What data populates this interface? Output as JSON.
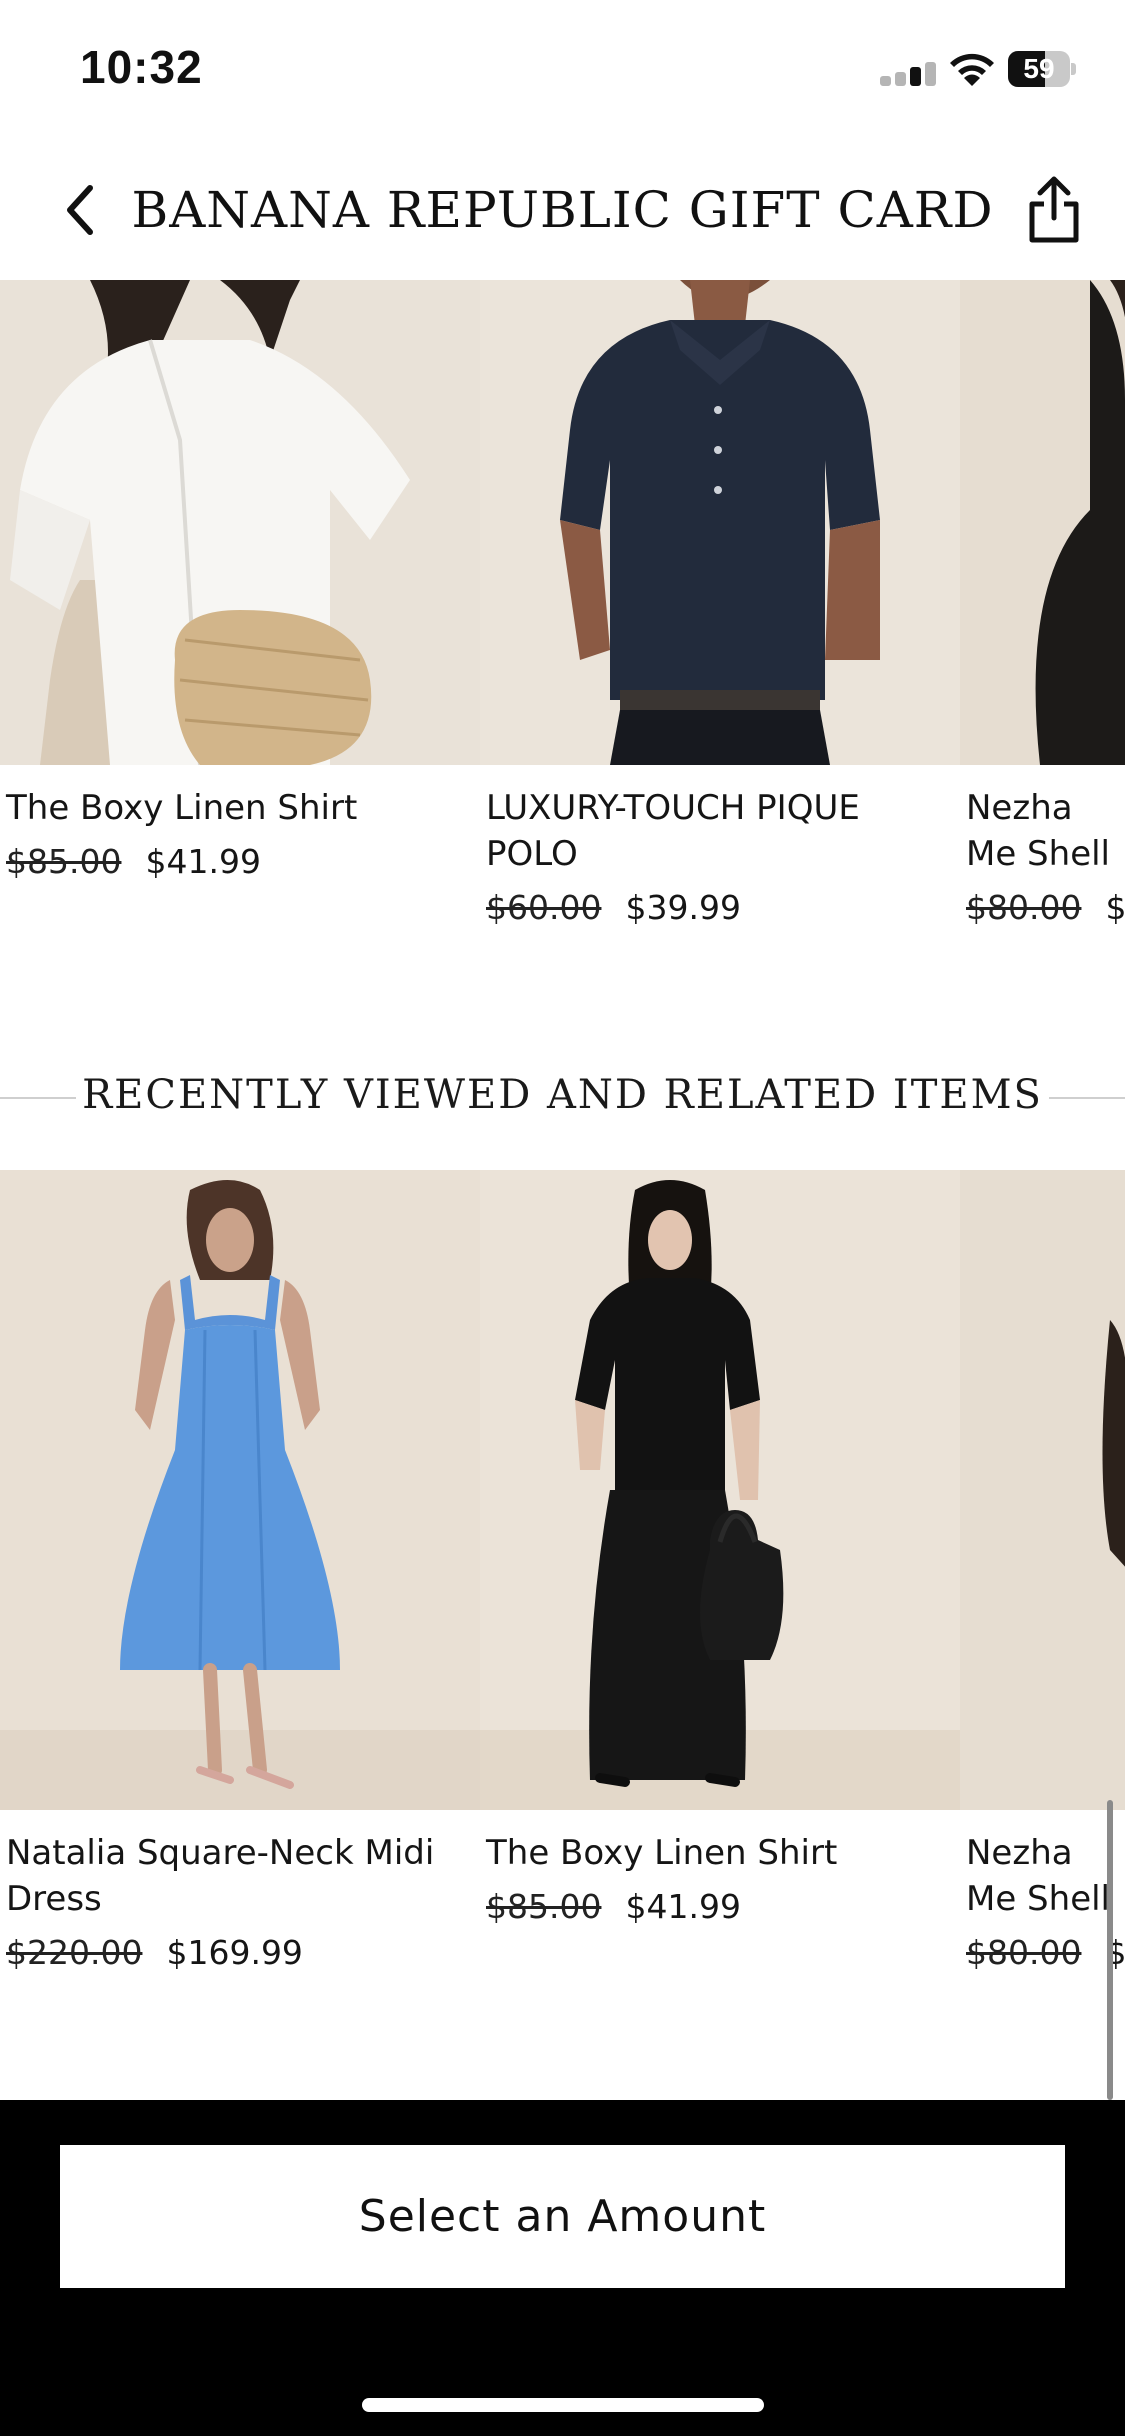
{
  "status_bar": {
    "time": "10:32",
    "battery_percent": "59",
    "battery_level": 0.59
  },
  "header": {
    "title": "BANANA REPUBLIC GIFT CARD",
    "back_icon": "chevron-left-icon",
    "share_icon": "share-icon"
  },
  "top_products": [
    {
      "name": "The Boxy Linen Shirt",
      "original_price": "$85.00",
      "sale_price": "$41.99",
      "image": "white-shirt-photo"
    },
    {
      "name": "LUXURY-TOUCH PIQUE POLO",
      "original_price": "$60.00",
      "sale_price": "$39.99",
      "image": "navy-polo-photo"
    },
    {
      "name": "Nezha Me Shell",
      "original_price": "$80.00",
      "sale_price": "$",
      "image": "black-top-photo"
    }
  ],
  "section": {
    "heading": "RECENTLY VIEWED AND RELATED ITEMS"
  },
  "related_products": [
    {
      "name": "Natalia Square-Neck Midi Dress",
      "original_price": "$220.00",
      "sale_price": "$169.99",
      "image": "blue-dress-photo"
    },
    {
      "name": "The Boxy Linen Shirt",
      "original_price": "$85.00",
      "sale_price": "$41.99",
      "image": "black-linen-set-photo"
    },
    {
      "name": "Nezha Me Shell",
      "original_price": "$80.00",
      "sale_price": "$",
      "image": "black-top-photo"
    }
  ],
  "footer": {
    "select_label": "Select an Amount"
  },
  "colors": {
    "background": "#ffffff",
    "bottom_bar": "#000000",
    "photo_backdrop": "#e8e0d6"
  }
}
